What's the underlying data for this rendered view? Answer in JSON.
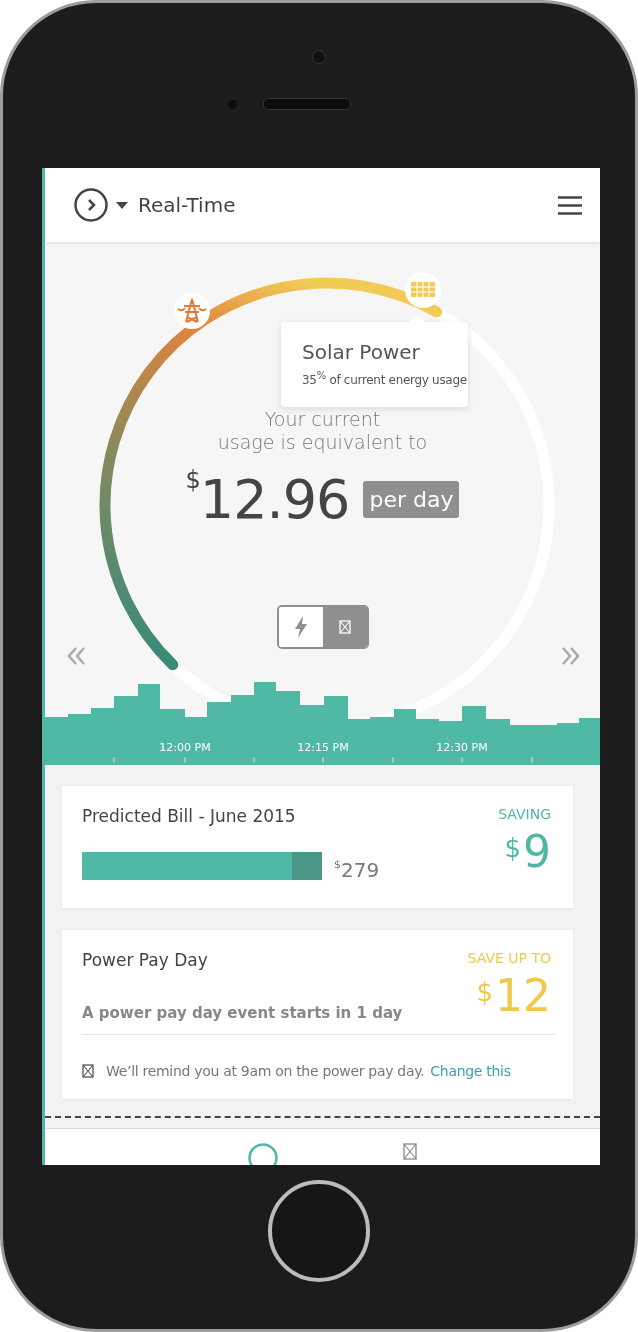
{
  "header": {
    "title": "Real-Time"
  },
  "gauge": {
    "tooltip": {
      "title": "Solar Power",
      "text": "35$^{%}$ of current energy usage"
    },
    "caption_lines": [
      "Your current",
      "usage is equivalent to"
    ],
    "currency": "$",
    "amount": "12.96",
    "period": "per day",
    "mode_toggle": [
      {
        "kind": "power",
        "selected": false
      },
      {
        "kind": "box",
        "selected": true
      }
    ],
    "time_labels": [
      "12:00 PM",
      "12:15 PM",
      "12:30 PM"
    ]
  },
  "bill_card": {
    "title": "Predicted Bill - June 2015",
    "level": 0.875,
    "currency": "$",
    "amount": "279",
    "saving_label": "SAVING",
    "saving_amount": "9"
  },
  "pay_day_card": {
    "title": "Power Pay Day",
    "description": "A power pay day event starts in 1 day",
    "save_label": "SAVE UP TO",
    "currency": "$",
    "save_amount": "12",
    "reminder": "We’ll remind you at 9am on the power pay day.",
    "link": "Change this"
  },
  "bottom_nav": [
    {
      "kind": "circle",
      "selected": true
    },
    {
      "kind": "box",
      "selected": false
    }
  ]
}
